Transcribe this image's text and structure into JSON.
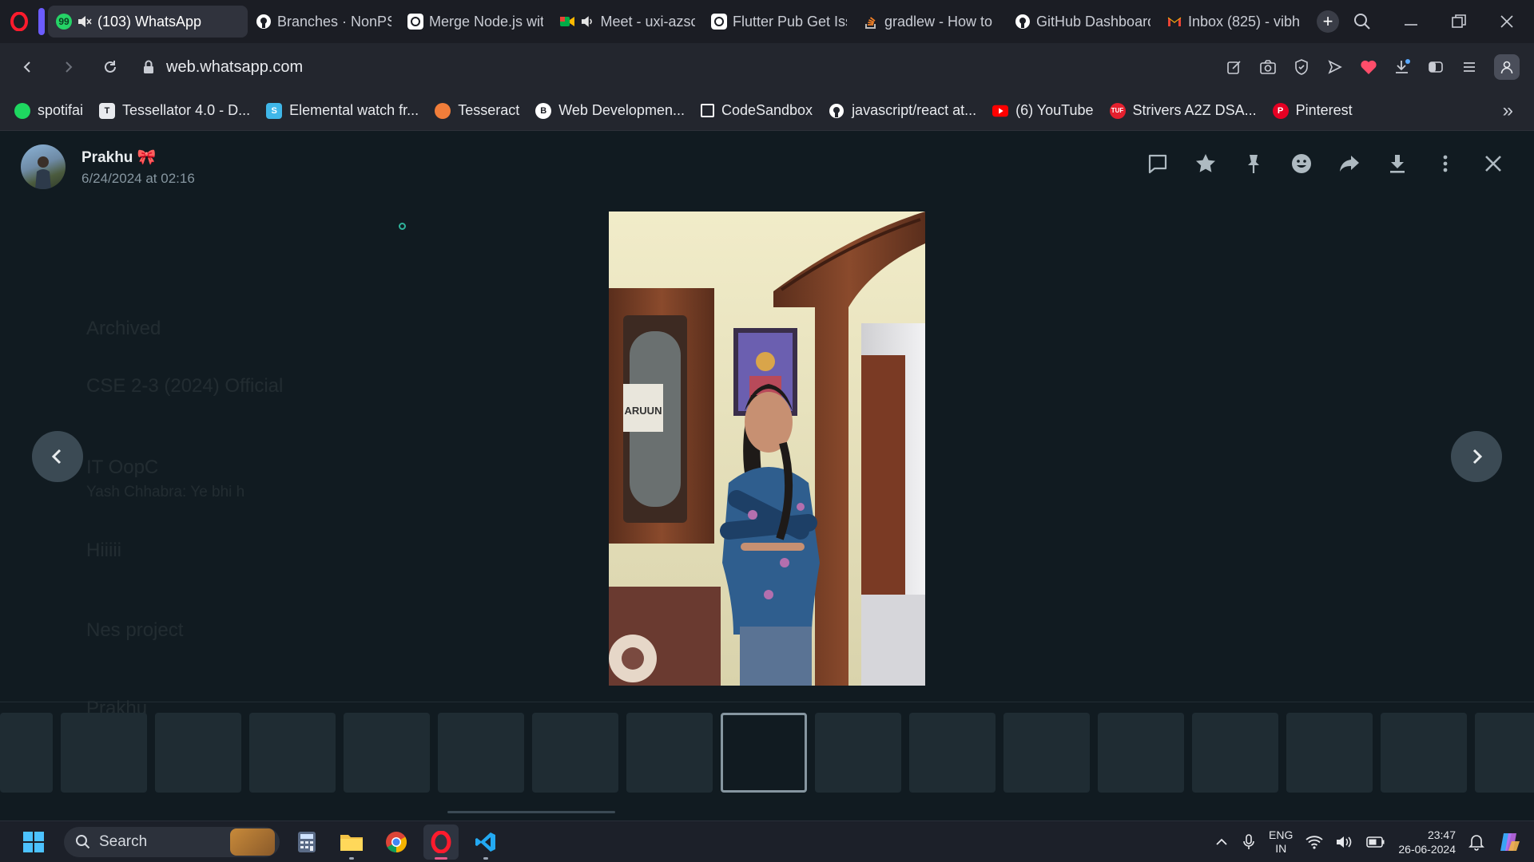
{
  "browser": {
    "tabs": [
      {
        "title": "(103) WhatsApp",
        "favicon": "whatsapp-icon",
        "badge": "99",
        "muted": true,
        "active": true
      },
      {
        "title": "Branches · NonPST",
        "favicon": "github-icon"
      },
      {
        "title": "Merge Node.js wit",
        "favicon": "chatgpt-icon"
      },
      {
        "title": "Meet - uxi-azsc",
        "favicon": "meet-icon",
        "audio": true
      },
      {
        "title": "Flutter Pub Get Iss",
        "favicon": "chatgpt-icon"
      },
      {
        "title": "gradlew - How to",
        "favicon": "stackoverflow-icon"
      },
      {
        "title": "GitHub Dashboard",
        "favicon": "github-icon"
      },
      {
        "title": "Inbox (825) - vibh",
        "favicon": "gmail-icon"
      }
    ],
    "url": "web.whatsapp.com",
    "bookmarks": [
      {
        "label": "spotifai",
        "icon": "spotify-icon",
        "color": "#1ed760"
      },
      {
        "label": "Tessellator 4.0 - D...",
        "icon": "devfolio-icon",
        "color": "#ffffff"
      },
      {
        "label": "Elemental watch fr...",
        "icon": "s-icon",
        "color": "#3fb6e8"
      },
      {
        "label": "Tesseract",
        "icon": "tesseract-icon",
        "color": "#f07d3a"
      },
      {
        "label": "Web Developmen...",
        "icon": "udemy-icon",
        "color": "#ffffff"
      },
      {
        "label": "CodeSandbox",
        "icon": "codesandbox-icon",
        "color": "#ffffff"
      },
      {
        "label": "javascript/react at...",
        "icon": "github-icon",
        "color": "#ffffff"
      },
      {
        "label": "(6) YouTube",
        "icon": "youtube-icon",
        "color": "#ff0000"
      },
      {
        "label": "Strivers A2Z DSA...",
        "icon": "tuf-icon",
        "color": "#e5202e"
      },
      {
        "label": "Pinterest",
        "icon": "pinterest-icon",
        "color": "#e60023"
      }
    ]
  },
  "viewer": {
    "sender_name": "Prakhu 🎀",
    "timestamp": "6/24/2024 at 02:16",
    "photo_sign_text": "ARUUN",
    "actions": [
      "reply-icon",
      "star-icon",
      "pin-icon",
      "emoji-icon",
      "forward-icon",
      "download-icon",
      "more-icon",
      "close-icon"
    ],
    "background_ghost": {
      "archived": "Archived",
      "chat1": "CSE 2-3 (2024) Official",
      "chat2": "IT OopC",
      "chat2_sub": "Yash Chhabra: Ye bhi h",
      "chat3": "Hiiiii",
      "chat4": "Nes project",
      "footer": "Prakhu"
    },
    "thumbnails": 17,
    "selected_thumbnail": 8
  },
  "taskbar": {
    "search_placeholder": "Search",
    "lang_line1": "ENG",
    "lang_line2": "IN",
    "time": "23:47",
    "date": "26-06-2024"
  },
  "colors": {
    "whatsapp_bg": "#111b21",
    "accent": "#00a884",
    "opera_red": "#ff1b2d"
  }
}
